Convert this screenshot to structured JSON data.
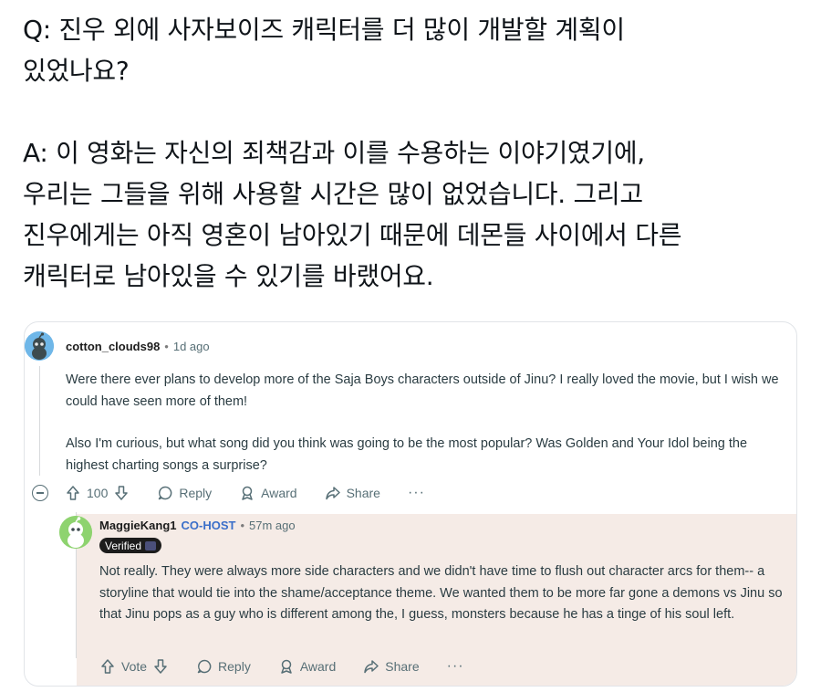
{
  "post": {
    "question": "Q: 진우 외에 사자보이즈 캐릭터를 더 많이 개발할 계획이\n있었나요?",
    "answer": "A: 이 영화는 자신의 죄책감과 이를 수용하는 이야기였기에,\n우리는 그들을 위해 사용할 시간은 많이 없었습니다. 그리고\n진우에게는 아직 영혼이 남아있기 때문에 데몬들 사이에서 다른\n캐릭터로 남아있을 수 있기를 바랬어요."
  },
  "comment": {
    "author": "cotton_clouds98",
    "time": "1d ago",
    "paragraph1": "Were there ever plans to develop more of the Saja Boys characters outside of Jinu? I really loved the movie, but I wish we could have seen more of them!",
    "paragraph2": "Also I'm curious, but what song did you think was going to be the most popular? Was Golden and Your Idol being the highest charting songs a surprise?",
    "votes": "100",
    "reply_label": "Reply",
    "award_label": "Award",
    "share_label": "Share",
    "more_label": "···"
  },
  "reply": {
    "author": "MaggieKang1",
    "flair": "CO-HOST",
    "time": "57m ago",
    "badge": "Verified",
    "text": "Not really. They were always more side characters and we didn't have time to flush out character arcs for them-- a storyline that would tie into the shame/acceptance theme. We wanted them to be more far gone a demons vs Jinu so that Jinu pops as a guy who is different among the, I guess, monsters because he has a tinge of his soul left.",
    "vote_label": "Vote",
    "reply_label": "Reply",
    "award_label": "Award",
    "share_label": "Share",
    "more_label": "···"
  },
  "colors": {
    "reply_background": "#f5ebe6",
    "cohost": "#3b6fc9",
    "meta": "#576f76"
  },
  "icons": [
    "snoo-avatar-icon",
    "upvote-icon",
    "downvote-icon",
    "comment-icon",
    "award-icon",
    "share-icon",
    "collapse-icon",
    "more-icon"
  ]
}
